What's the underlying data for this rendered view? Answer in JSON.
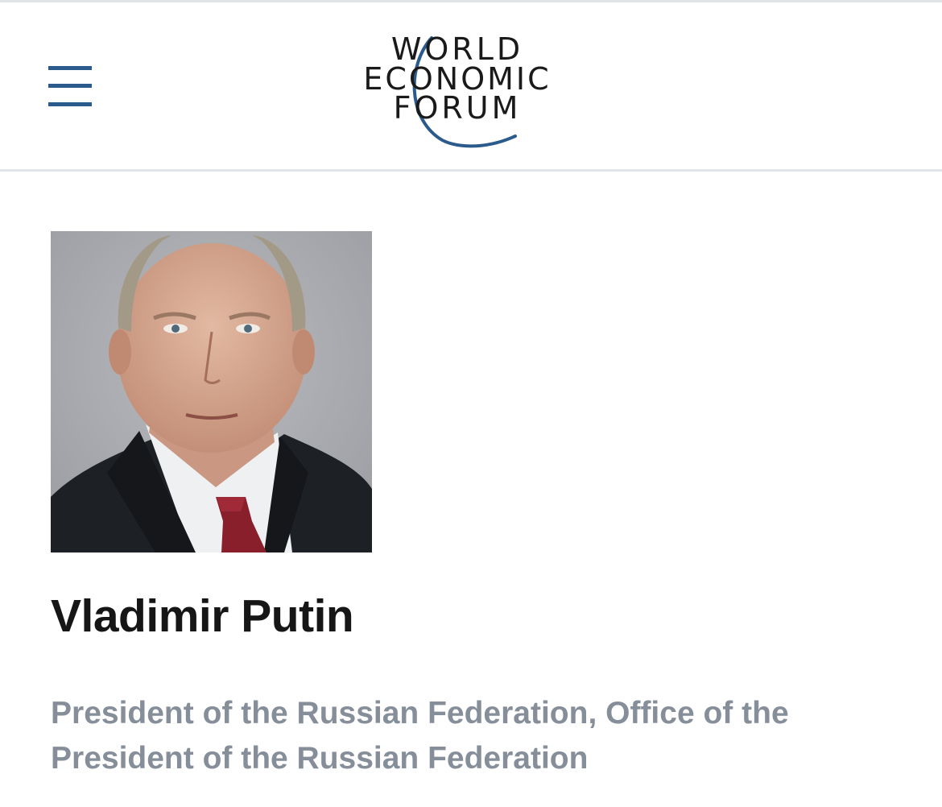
{
  "header": {
    "menu_icon": "hamburger-menu-icon",
    "logo": {
      "line1": "WORLD",
      "line2": "ECONOMIC",
      "line3": "FORUM",
      "accent_color": "#2b5a8c"
    }
  },
  "profile": {
    "name": "Vladimir Putin",
    "title": "President of the Russian Federation, Office of the President of the Russian Federation",
    "colors": {
      "name": "#161616",
      "title": "#858e99"
    }
  }
}
